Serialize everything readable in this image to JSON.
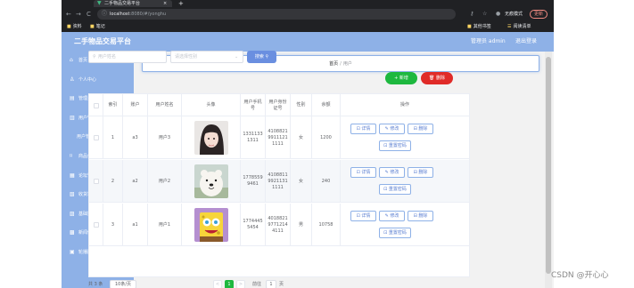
{
  "browser": {
    "tab_title": "二手物品交易平台",
    "tab_close": "×",
    "new_tab": "+",
    "back": "←",
    "forward": "→",
    "reload": "C",
    "url_host": "localhost",
    "url_rest": ":8080/#/yonghu",
    "incognito_label": "无痕模式",
    "update_label": "更新",
    "bookmarks": [
      "资料",
      "笔记"
    ],
    "bookmarks_right": [
      "其他书签",
      "阅读清单"
    ]
  },
  "header": {
    "title": "二手物品交易平台",
    "user_label": "管理员 admin",
    "logout_label": "退出登录"
  },
  "sidebar": {
    "items": [
      {
        "label": "首页",
        "icon": "home-icon"
      },
      {
        "label": "个人中心",
        "icon": "user-icon"
      },
      {
        "label": "管理员管理",
        "icon": "admin-icon"
      },
      {
        "label": "用户管理",
        "icon": "folder-icon"
      },
      {
        "label": "用户管理",
        "icon": "",
        "sub": true
      },
      {
        "label": "商品信息管理",
        "icon": "goods-icon"
      },
      {
        "label": "论坛管理",
        "icon": "forum-icon"
      },
      {
        "label": "收货地址管理",
        "icon": "address-icon"
      },
      {
        "label": "基础数据管理",
        "icon": "data-icon"
      },
      {
        "label": "新闻信息管理",
        "icon": "news-icon"
      },
      {
        "label": "轮播图信息",
        "icon": "carousel-icon"
      }
    ]
  },
  "breadcrumb": {
    "home": "首页",
    "separator": "/",
    "current": "用户"
  },
  "search": {
    "input_placeholder": "用户姓名",
    "select_placeholder": "请选择性别",
    "button_label": "搜索"
  },
  "actions": {
    "add_label": "新增",
    "delete_label": "删除"
  },
  "table": {
    "headers": [
      "",
      "索引",
      "账户",
      "用户姓名",
      "头像",
      "用户手机号",
      "用户身份证号",
      "性别",
      "余额",
      "操作"
    ],
    "rows": [
      {
        "index": "1",
        "account": "a3",
        "name": "用户3",
        "phone": "13311331311",
        "idcard": "410882199111211111",
        "gender": "女",
        "balance": "1200",
        "avatar": "girl-avatar"
      },
      {
        "index": "2",
        "account": "a2",
        "name": "用户2",
        "phone": "17785599461",
        "idcard": "410881199211311111",
        "gender": "女",
        "balance": "240",
        "avatar": "bear-avatar"
      },
      {
        "index": "3",
        "account": "a1",
        "name": "用户1",
        "phone": "17744455454",
        "idcard": "401882197712144111",
        "gender": "男",
        "balance": "10758",
        "avatar": "sponge-avatar"
      }
    ],
    "ops": [
      "详情",
      "修改",
      "删除",
      "重置密码"
    ]
  },
  "pagination": {
    "total": "共 3 条",
    "page_size": "10条/页",
    "prev": "<",
    "current": "1",
    "next": ">",
    "goto_prefix": "前往",
    "goto_value": "1",
    "goto_suffix": "页"
  },
  "watermark": "CSDN @开心心"
}
